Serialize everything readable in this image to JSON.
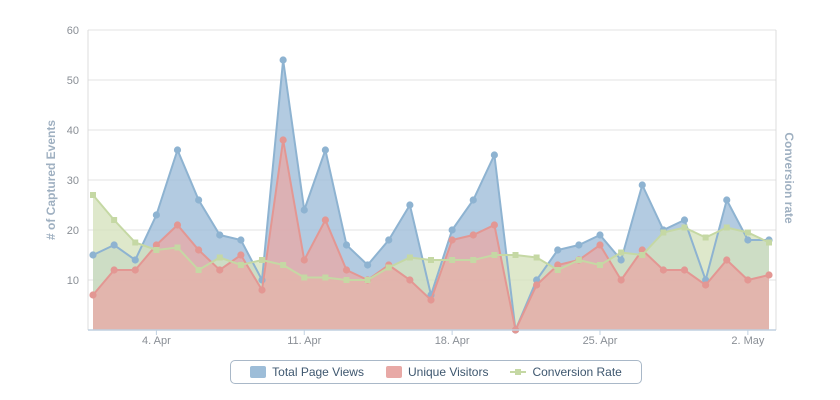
{
  "chart_data": {
    "type": "area",
    "x_ticks": [
      "4. Apr",
      "11. Apr",
      "18. Apr",
      "25. Apr",
      "2. May"
    ],
    "y_left": {
      "label": "# of Captured Events",
      "range": [
        0,
        60
      ],
      "ticks": [
        "60",
        "50",
        "40",
        "30",
        "20",
        "10"
      ]
    },
    "y_right": {
      "label": "Conversion rate"
    },
    "grid": true,
    "legend_position": "bottom",
    "dates": [
      "2013-04-01",
      "2013-04-02",
      "2013-04-03",
      "2013-04-04",
      "2013-04-05",
      "2013-04-06",
      "2013-04-07",
      "2013-04-08",
      "2013-04-09",
      "2013-04-10",
      "2013-04-11",
      "2013-04-12",
      "2013-04-13",
      "2013-04-14",
      "2013-04-15",
      "2013-04-16",
      "2013-04-17",
      "2013-04-18",
      "2013-04-19",
      "2013-04-20",
      "2013-04-21",
      "2013-04-22",
      "2013-04-23",
      "2013-04-24",
      "2013-04-25",
      "2013-04-26",
      "2013-04-27",
      "2013-04-28",
      "2013-04-29",
      "2013-04-30",
      "2013-05-01",
      "2013-05-02",
      "2013-05-03"
    ],
    "series": [
      {
        "name": "Total Page Views",
        "color": "#9dbdd8",
        "line": "#8eb3d1",
        "values": [
          15,
          17,
          14,
          23,
          36,
          26,
          19,
          18,
          10,
          54,
          24,
          36,
          17,
          13,
          18,
          25,
          7,
          20,
          26,
          35,
          0,
          10,
          16,
          17,
          19,
          14,
          29,
          20,
          22,
          10,
          26,
          18,
          18
        ]
      },
      {
        "name": "Unique Visitors",
        "color": "#e8a9a6",
        "line": "#e39793",
        "values": [
          7,
          12,
          12,
          17,
          21,
          16,
          12,
          15,
          8,
          38,
          14,
          22,
          12,
          10,
          13,
          10,
          6,
          18,
          19,
          21,
          0,
          9,
          13,
          14,
          17,
          10,
          16,
          12,
          12,
          9,
          14,
          10,
          11
        ]
      },
      {
        "name": "Conversion Rate",
        "color": "#d5e2bd",
        "line": "#c5d8a4",
        "values": [
          27,
          22,
          17.5,
          16,
          16.5,
          12,
          14.5,
          13,
          14,
          13,
          10.5,
          10.5,
          10,
          10,
          12.5,
          14.5,
          14,
          14,
          14,
          15,
          15,
          14.5,
          12,
          14,
          13,
          15.5,
          15,
          19.5,
          20.5,
          18.5,
          20.5,
          19.5,
          17.5
        ]
      }
    ]
  },
  "legend": {
    "total_page_views": "Total Page Views",
    "unique_visitors": "Unique Visitors",
    "conversion_rate": "Conversion Rate"
  }
}
